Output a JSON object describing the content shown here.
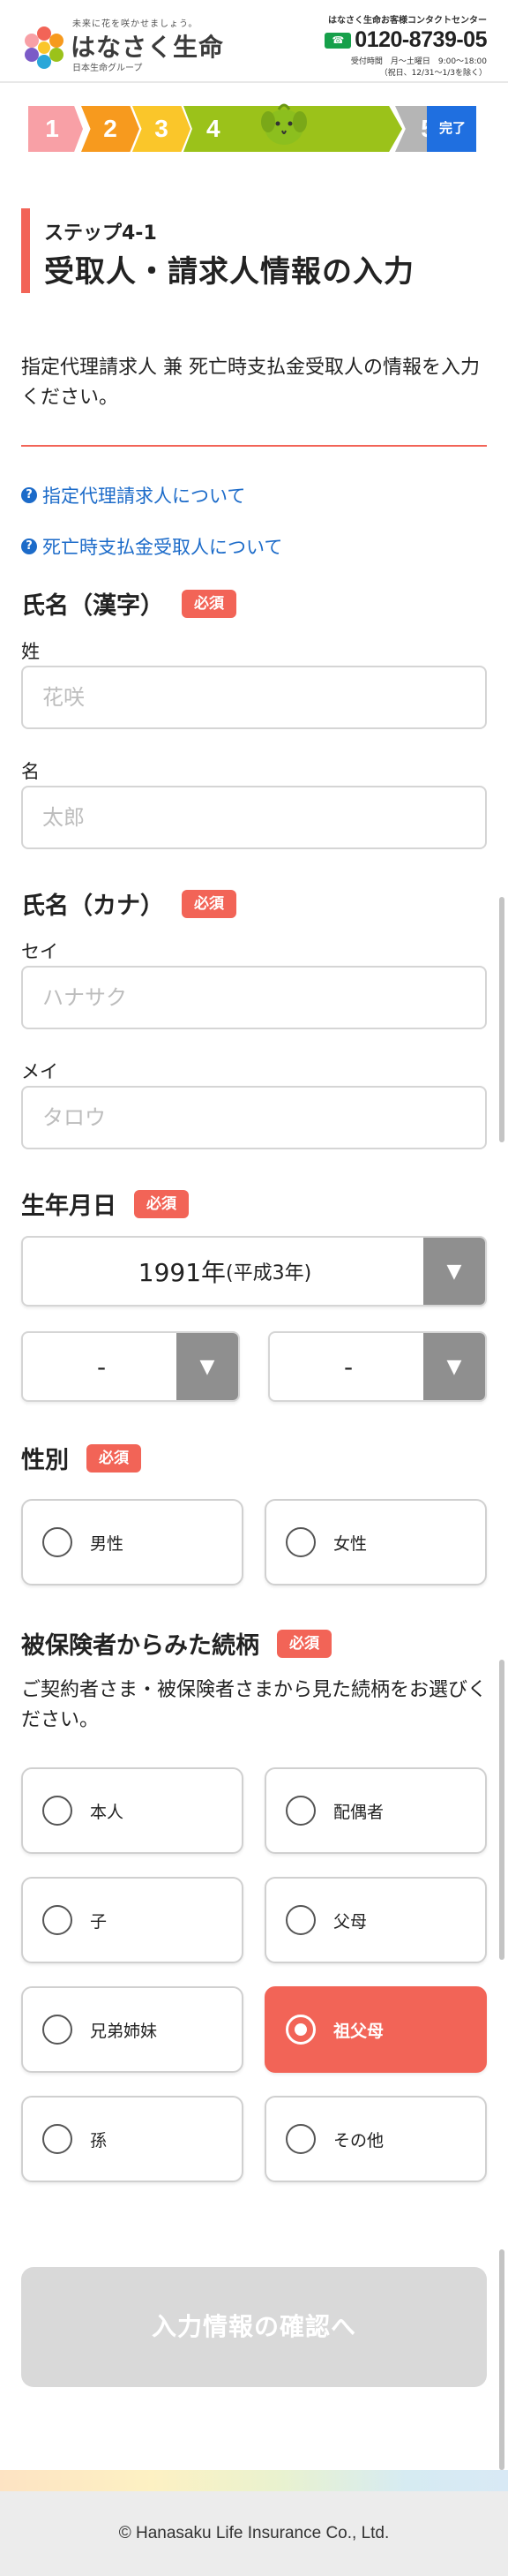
{
  "header": {
    "tagline": "未来に花を咲かせましょう。",
    "brand": "はなさく生命",
    "group": "日本生命グループ",
    "contact_title": "はなさく生命お客様コンタクトセンター",
    "freedial_icon": "freedial-icon",
    "phone": "0120-8739-05",
    "hours": "受付時間　月〜土曜日　9:00〜18:00",
    "holiday": "（祝日、12/31〜1/3を除く）"
  },
  "steps": [
    {
      "label": "1",
      "color": "#f8a0a6"
    },
    {
      "label": "2",
      "color": "#f79a1e"
    },
    {
      "label": "3",
      "color": "#fac62a"
    },
    {
      "label": "4",
      "color": "#9bc21a"
    },
    {
      "label": "5",
      "color": "#b5b5b5"
    },
    {
      "label": "完了",
      "color": "#1f6fe0"
    }
  ],
  "current_step": 4,
  "title": {
    "sub": "ステップ4-1",
    "main": "受取人・請求人情報の入力"
  },
  "intro": "指定代理請求人 兼 死亡時支払金受取人の情報を入力ください。",
  "help_links": [
    "指定代理請求人について",
    "死亡時支払金受取人について"
  ],
  "required_label": "必須",
  "name_kanji": {
    "label": "氏名（漢字）",
    "last_label": "姓",
    "last_placeholder": "花咲",
    "last_value": "",
    "first_label": "名",
    "first_placeholder": "太郎",
    "first_value": ""
  },
  "name_kana": {
    "label": "氏名（カナ）",
    "last_label": "セイ",
    "last_placeholder": "ハナサク",
    "last_value": "",
    "first_label": "メイ",
    "first_placeholder": "タロウ",
    "first_value": ""
  },
  "birthdate": {
    "label": "生年月日",
    "year": "1991年",
    "era": "(平成3年)",
    "month": "-",
    "day": "-"
  },
  "gender": {
    "label": "性別",
    "options": [
      "男性",
      "女性"
    ],
    "selected": null
  },
  "relationship": {
    "label": "被保険者からみた続柄",
    "note": "ご契約者さま・被保険者さまから見た続柄をお選びください。",
    "options": [
      "本人",
      "配偶者",
      "子",
      "父母",
      "兄弟姉妹",
      "祖父母",
      "孫",
      "その他"
    ],
    "selected": "祖父母"
  },
  "submit_label": "入力情報の確認へ",
  "footer": "© Hanasaku Life Insurance Co., Ltd.",
  "colors": {
    "accent": "#f26457",
    "link": "#1c6bc9",
    "disabled_button": "#d9d9d9"
  }
}
